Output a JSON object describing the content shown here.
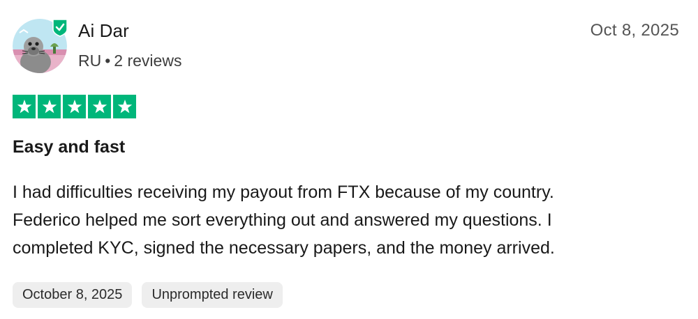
{
  "reviewer": {
    "name": "Ai Dar",
    "country": "RU",
    "separator": "•",
    "review_count": "2 reviews",
    "avatar_icon": "seal-avatar-icon",
    "verified_icon": "verified-shield-icon"
  },
  "review": {
    "date": "Oct 8, 2025",
    "rating": 5,
    "rating_max": 5,
    "star_color": "#00b67a",
    "title": "Easy and fast",
    "body_lines": [
      "I had difficulties receiving my payout from FTX because of my country.",
      "Federico helped me sort everything out and answered my questions. I",
      "completed KYC, signed the necessary papers, and the money arrived."
    ]
  },
  "tags": {
    "date_of_experience": "October 8, 2025",
    "review_type": "Unprompted review"
  }
}
